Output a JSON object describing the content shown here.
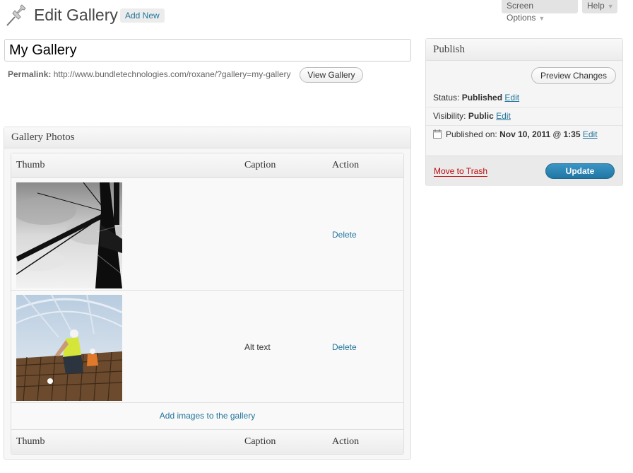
{
  "header": {
    "screen_options": "Screen Options",
    "help": "Help",
    "title": "Edit Gallery",
    "add_new": "Add New"
  },
  "post": {
    "title": "My Gallery",
    "permalink_label": "Permalink:",
    "permalink_url": "http://www.bundletechnologies.com/roxane/?gallery=my-gallery",
    "view_button": "View Gallery"
  },
  "gallery": {
    "box_title": "Gallery Photos",
    "columns": {
      "thumb": "Thumb",
      "caption": "Caption",
      "action": "Action"
    },
    "rows": [
      {
        "caption": "",
        "action": "Delete",
        "thumb": "crane-photo"
      },
      {
        "caption": "Alt text",
        "action": "Delete",
        "thumb": "construction-workers-photo"
      }
    ],
    "add_images": "Add images to the gallery"
  },
  "publish": {
    "box_title": "Publish",
    "preview_button": "Preview Changes",
    "status_label": "Status:",
    "status_value": "Published",
    "visibility_label": "Visibility:",
    "visibility_value": "Public",
    "published_label": "Published on:",
    "published_value": "Nov 10, 2011 @ 1:35",
    "edit_label": "Edit",
    "trash_label": "Move to Trash",
    "update_button": "Update"
  }
}
